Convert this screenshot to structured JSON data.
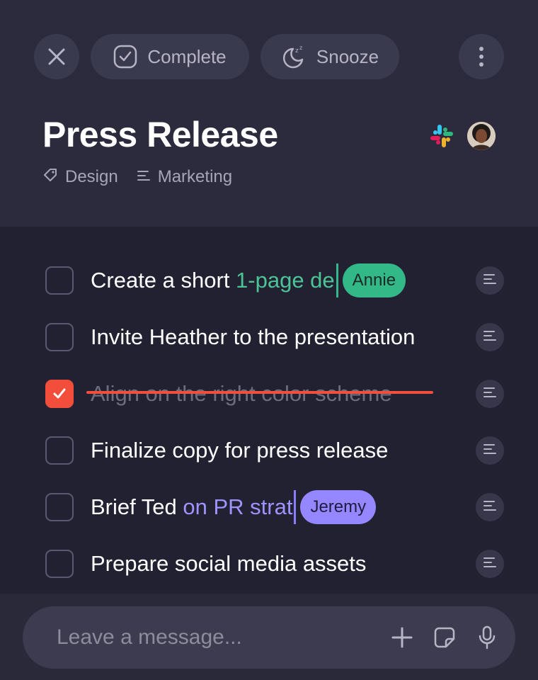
{
  "toolbar": {
    "complete_label": "Complete",
    "snooze_label": "Snooze"
  },
  "task": {
    "title": "Press Release",
    "tags": [
      {
        "label": "Design",
        "icon": "tag-icon"
      },
      {
        "label": "Marketing",
        "icon": "lines-icon"
      }
    ]
  },
  "subtasks": [
    {
      "text_plain": "Create a short ",
      "text_live": "1-page de",
      "collaborator": "Annie",
      "done": false
    },
    {
      "text_plain": "Invite Heather to the presentation",
      "done": false
    },
    {
      "text_plain": "Align on the right color scheme",
      "done": true
    },
    {
      "text_plain": "Finalize copy for press release",
      "done": false
    },
    {
      "text_plain": "Brief Ted ",
      "text_live": "on PR strat",
      "collaborator": "Jeremy",
      "done": false
    },
    {
      "text_plain": "Prepare social media assets",
      "done": false
    }
  ],
  "composer": {
    "placeholder": "Leave a message..."
  },
  "colors": {
    "accent_red": "#f24e3b",
    "annie_green": "#33b987",
    "jeremy_purple": "#9487ff"
  }
}
